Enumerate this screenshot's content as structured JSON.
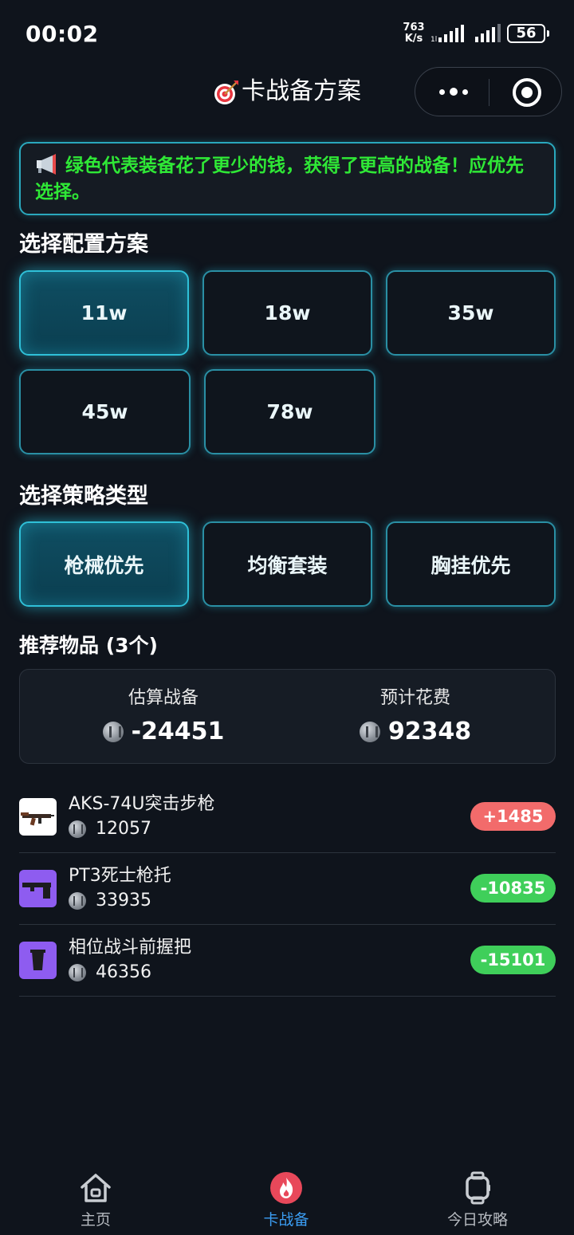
{
  "status_bar": {
    "time": "00:02",
    "net_speed_value": "763",
    "net_speed_unit": "K/s",
    "battery": "56"
  },
  "header": {
    "title": "卡战备方案",
    "title_icon": "dart-target-icon"
  },
  "notice": {
    "icon": "megaphone-icon",
    "text": "绿色代表装备花了更少的钱，获得了更高的战备！应优先选择。"
  },
  "config_section": {
    "label": "选择配置方案",
    "options": [
      "11w",
      "18w",
      "35w",
      "45w",
      "78w"
    ],
    "selected": "11w"
  },
  "strategy_section": {
    "label": "选择策略类型",
    "options": [
      "枪械优先",
      "均衡套装",
      "胸挂优先"
    ],
    "selected": "枪械优先"
  },
  "recommend": {
    "label": "推荐物品 (3个)",
    "summary": {
      "estimate_label": "估算战备",
      "estimate_value": "-24451",
      "cost_label": "预计花费",
      "cost_value": "92348"
    },
    "items": [
      {
        "name": "AKS-74U突击步枪",
        "price": "12057",
        "diff": "+1485",
        "diff_color": "#f26b6b",
        "thumb_bg": "#ffffff",
        "icon": "rifle-icon"
      },
      {
        "name": "PT3死士枪托",
        "price": "33935",
        "diff": "-10835",
        "diff_color": "#3fcf5a",
        "thumb_bg": "#8e5cf0",
        "icon": "gun-stock-icon"
      },
      {
        "name": "相位战斗前握把",
        "price": "46356",
        "diff": "-15101",
        "diff_color": "#3fcf5a",
        "thumb_bg": "#8e5cf0",
        "icon": "foregrip-icon"
      }
    ]
  },
  "tabbar": {
    "tabs": [
      {
        "label": "主页",
        "icon": "home-icon"
      },
      {
        "label": "卡战备",
        "icon": "flame-icon"
      },
      {
        "label": "今日攻略",
        "icon": "watch-icon"
      }
    ],
    "active": "卡战备",
    "active_color": "#3b9df2",
    "accent_color": "#e8485a"
  },
  "colors": {
    "background": "#0f141c",
    "accent_cyan": "#2fc0d8",
    "notice_green": "#2fe836"
  }
}
